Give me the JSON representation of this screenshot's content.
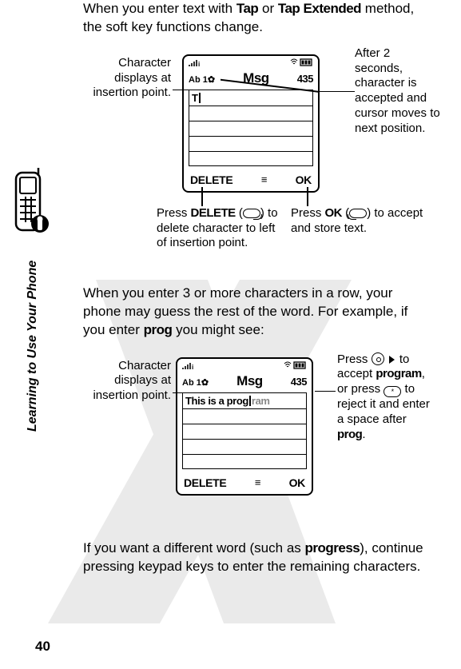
{
  "sideLabel": "Learning to Use Your Phone",
  "pageNumber": "40",
  "para1_a": "When you enter text with ",
  "para1_b": "Tap",
  "para1_c": " or ",
  "para1_d": "Tap Extended",
  "para1_e": " method, the soft key functions change.",
  "fig1": {
    "calloutLeft": "Character displays at insertion point.",
    "calloutRightTop": "After 2 seconds, character is accepted and cursor moves to next position.",
    "calloutBL_a": "Press ",
    "calloutBL_b": "DELETE",
    "calloutBL_c": " (",
    "calloutBL_d": ") to delete character to left of insertion point.",
    "calloutBR_a": "Press ",
    "calloutBR_b": "OK",
    "calloutBR_c": " (",
    "calloutBR_d": ") to accept and store text.",
    "screen": {
      "mode": "Ab 1",
      "title": "Msg",
      "count": "435",
      "entered": "T",
      "softLeft": "DELETE",
      "softRight": "OK"
    }
  },
  "para2_a": "When you enter 3 or more characters in a row, your phone may guess the rest of the word. For example, if you enter ",
  "para2_b": "prog",
  "para2_c": " you might see:",
  "fig2": {
    "calloutLeft": "Character displays at insertion point.",
    "calloutR_a": "Press ",
    "calloutR_b": " to accept ",
    "calloutR_c": "program",
    "calloutR_d": ", or press ",
    "calloutR_e": " to reject it and enter a space after ",
    "calloutR_f": "prog",
    "calloutR_g": ".",
    "starKey": "*",
    "screen": {
      "mode": "Ab 1",
      "title": "Msg",
      "count": "435",
      "entered": "This is a prog",
      "suggest": "ram",
      "softLeft": "DELETE",
      "softRight": "OK"
    }
  },
  "para3_a": "If you want a different word (such as ",
  "para3_b": "progress",
  "para3_c": "), continue pressing keypad keys to enter the remaining characters."
}
